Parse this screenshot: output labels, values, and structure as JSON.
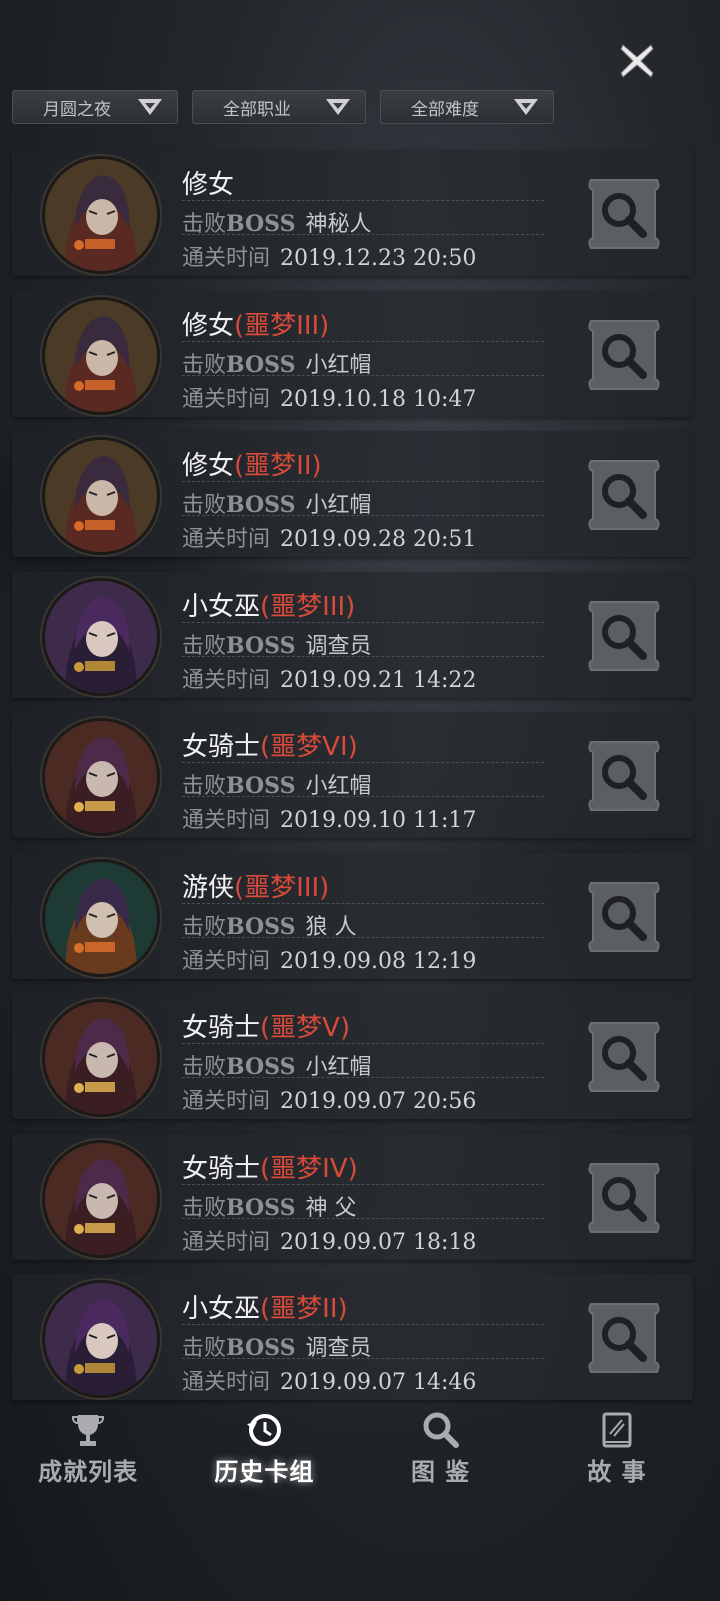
{
  "filters": [
    {
      "label": "月圆之夜"
    },
    {
      "label": "全部职业"
    },
    {
      "label": "全部难度"
    }
  ],
  "labels": {
    "boss_prefix": "击败",
    "boss_en": "BOSS",
    "time_label": "通关时间"
  },
  "records": [
    {
      "name": "修女",
      "level": "",
      "boss": "神秘人",
      "time": "2019.12.23 20:50",
      "avatar": "nun"
    },
    {
      "name": "修女",
      "level": "(噩梦III)",
      "boss": "小红帽",
      "time": "2019.10.18 10:47",
      "avatar": "nun"
    },
    {
      "name": "修女",
      "level": "(噩梦II)",
      "boss": "小红帽",
      "time": "2019.09.28 20:51",
      "avatar": "nun"
    },
    {
      "name": "小女巫",
      "level": "(噩梦III)",
      "boss": "调查员",
      "time": "2019.09.21 14:22",
      "avatar": "witch"
    },
    {
      "name": "女骑士",
      "level": "(噩梦VI)",
      "boss": "小红帽",
      "time": "2019.09.10 11:17",
      "avatar": "knight"
    },
    {
      "name": "游侠",
      "level": "(噩梦III)",
      "boss": "狼 人",
      "time": "2019.09.08 12:19",
      "avatar": "ranger"
    },
    {
      "name": "女骑士",
      "level": "(噩梦V)",
      "boss": "小红帽",
      "time": "2019.09.07 20:56",
      "avatar": "knight"
    },
    {
      "name": "女骑士",
      "level": "(噩梦IV)",
      "boss": "神 父",
      "time": "2019.09.07 18:18",
      "avatar": "knight"
    },
    {
      "name": "小女巫",
      "level": "(噩梦II)",
      "boss": "调查员",
      "time": "2019.09.07 14:46",
      "avatar": "witch"
    }
  ],
  "tabs": [
    {
      "label": "成就列表",
      "icon": "trophy-icon",
      "active": false
    },
    {
      "label": "历史卡组",
      "icon": "history-icon",
      "active": true
    },
    {
      "label": "图 鉴",
      "icon": "magnifier-icon",
      "active": false
    },
    {
      "label": "故 事",
      "icon": "book-icon",
      "active": false
    }
  ],
  "colors": {
    "level_red": "#d84a3a",
    "label_gray": "#8e9094",
    "value_light": "#c6c8ca"
  }
}
